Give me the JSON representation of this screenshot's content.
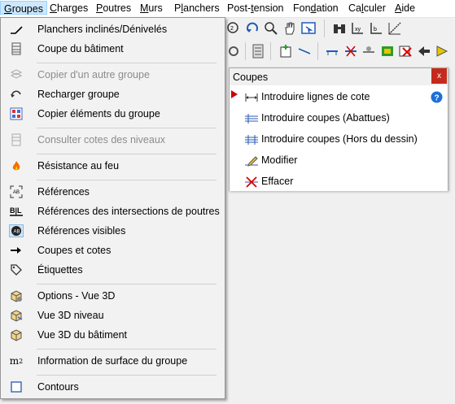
{
  "menubar": {
    "items": [
      {
        "label": "Groupes"
      },
      {
        "label": "Charges"
      },
      {
        "label": "Poutres"
      },
      {
        "label": "Murs"
      },
      {
        "label": "Planchers"
      },
      {
        "label": "Post-tension"
      },
      {
        "label": "Fondation"
      },
      {
        "label": "Calculer"
      },
      {
        "label": "Aide"
      }
    ]
  },
  "dropdown": {
    "items": [
      {
        "label": "Planchers inclinés/Dénivelés",
        "icon": "slope-icon",
        "disabled": false
      },
      {
        "label": "Coupe du bâtiment",
        "icon": "building-section-icon",
        "disabled": false
      },
      {
        "label": "Copier d'un autre groupe",
        "icon": "copy-group-icon",
        "disabled": true
      },
      {
        "label": "Recharger groupe",
        "icon": "reload-icon",
        "disabled": false
      },
      {
        "label": "Copier éléments du groupe",
        "icon": "copy-elements-icon",
        "disabled": false
      },
      {
        "label": "Consulter cotes des niveaux",
        "icon": "levels-icon",
        "disabled": true
      },
      {
        "label": "Résistance au feu",
        "icon": "fire-icon",
        "disabled": false
      },
      {
        "label": "Références",
        "icon": "references-icon",
        "disabled": false
      },
      {
        "label": "Références des intersections de poutres",
        "icon": "beam-intersection-icon",
        "disabled": false
      },
      {
        "label": "Références visibles",
        "icon": "visible-references-icon",
        "disabled": false,
        "checked": true
      },
      {
        "label": "Coupes et cotes",
        "icon": "arrow-right-icon",
        "disabled": false
      },
      {
        "label": "Étiquettes",
        "icon": "tag-icon",
        "disabled": false
      },
      {
        "label": "Options - Vue 3D",
        "icon": "3d-options-icon",
        "disabled": false
      },
      {
        "label": "Vue 3D niveau",
        "icon": "3d-level-icon",
        "disabled": false
      },
      {
        "label": "Vue 3D du bâtiment",
        "icon": "3d-building-icon",
        "disabled": false
      },
      {
        "label": "Information de surface du groupe",
        "icon": "m2",
        "disabled": false
      },
      {
        "label": "Contours",
        "icon": "contour-icon",
        "disabled": false
      }
    ]
  },
  "panel": {
    "title": "Coupes",
    "close": "x",
    "items": [
      {
        "label": "Introduire lignes de cote",
        "icon": "dimension-line-icon"
      },
      {
        "label": "Introduire coupes (Abattues)",
        "icon": "section-folded-icon"
      },
      {
        "label": "Introduire coupes (Hors du dessin)",
        "icon": "section-outside-icon"
      },
      {
        "label": "Modifier",
        "icon": "edit-icon"
      },
      {
        "label": "Effacer",
        "icon": "delete-icon"
      }
    ],
    "help_icon": "?"
  }
}
